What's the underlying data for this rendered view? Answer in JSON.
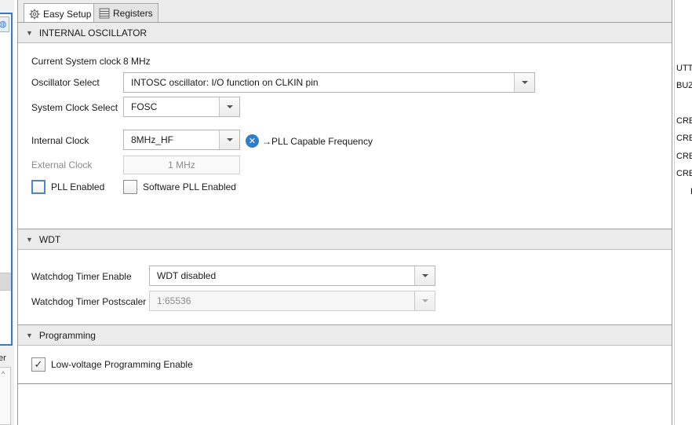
{
  "tabs": [
    {
      "label": "Easy Setup",
      "icon": "gear-icon",
      "active": true
    },
    {
      "label": "Registers",
      "icon": "list-icon",
      "active": false
    }
  ],
  "oscillator": {
    "header": "INTERNAL OSCILLATOR",
    "current_clock_label": "Current System clock",
    "current_clock_value": "8 MHz",
    "osc_select_label": "Oscillator Select",
    "osc_select_value": "INTOSC oscillator: I/O function on CLKIN pin",
    "sys_clock_label": "System Clock Select",
    "sys_clock_value": "FOSC",
    "internal_clock_label": "Internal Clock",
    "internal_clock_value": "8MHz_HF",
    "pll_capable_text": "→PLL Capable Frequency",
    "external_clock_label": "External Clock",
    "external_clock_value": "1 MHz",
    "pll_enabled_label": "PLL Enabled",
    "pll_enabled_checked": false,
    "sw_pll_label": "Software PLL Enabled",
    "sw_pll_checked": false
  },
  "wdt": {
    "header": "WDT",
    "enable_label": "Watchdog Timer Enable",
    "enable_value": "WDT disabled",
    "postscaler_label": "Watchdog Timer Postscaler",
    "postscaler_value": "1:65536"
  },
  "programming": {
    "header": "Programming",
    "lvp_label": "Low-voltage Programming Enable",
    "lvp_checked": true
  },
  "left_panel": {
    "partial_label": "er"
  },
  "right_panel": {
    "items": [
      "UTTO",
      "BUZ",
      "CRE",
      "CRE",
      "CRE",
      "CRE",
      "F"
    ]
  },
  "colors": {
    "accent": "#3b78c2",
    "info_icon": "#2f7fc8",
    "header_bg": "#ececec"
  }
}
